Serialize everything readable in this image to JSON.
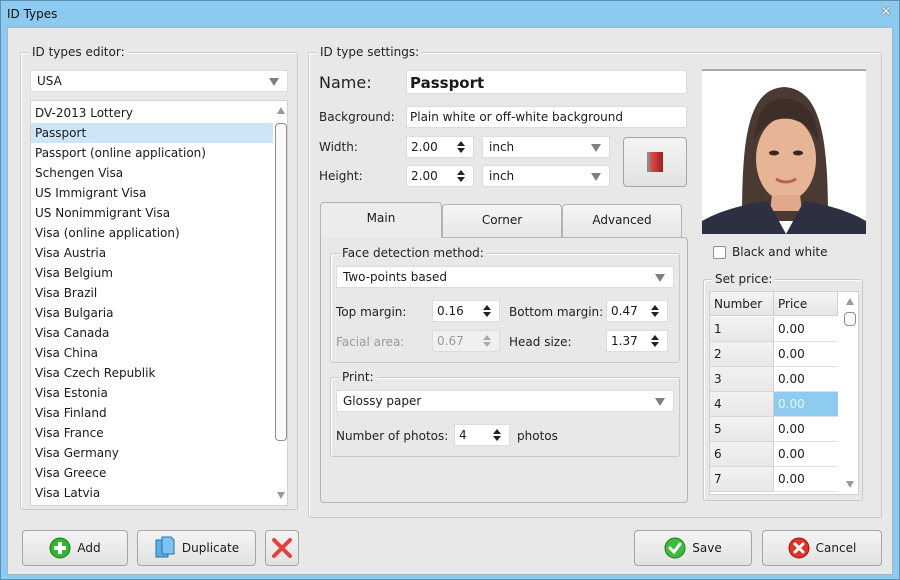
{
  "window": {
    "title": "ID Types",
    "close_icon": "close-icon"
  },
  "editor": {
    "group_label": "ID types editor:",
    "country_selected": "USA",
    "items": [
      {
        "label": "DV-2013 Lottery",
        "selected": false
      },
      {
        "label": "Passport",
        "selected": true
      },
      {
        "label": "Passport (online application)",
        "selected": false
      },
      {
        "label": "Schengen Visa",
        "selected": false
      },
      {
        "label": "US Immigrant Visa",
        "selected": false
      },
      {
        "label": "US Nonimmigrant Visa",
        "selected": false
      },
      {
        "label": "Visa (online application)",
        "selected": false
      },
      {
        "label": "Visa Austria",
        "selected": false
      },
      {
        "label": "Visa Belgium",
        "selected": false
      },
      {
        "label": "Visa Brazil",
        "selected": false
      },
      {
        "label": "Visa Bulgaria",
        "selected": false
      },
      {
        "label": "Visa Canada",
        "selected": false
      },
      {
        "label": "Visa China",
        "selected": false
      },
      {
        "label": "Visa Czech Republik",
        "selected": false
      },
      {
        "label": "Visa Estonia",
        "selected": false
      },
      {
        "label": "Visa Finland",
        "selected": false
      },
      {
        "label": "Visa France",
        "selected": false
      },
      {
        "label": "Visa Germany",
        "selected": false
      },
      {
        "label": "Visa Greece",
        "selected": false
      },
      {
        "label": "Visa Latvia",
        "selected": false
      }
    ]
  },
  "settings": {
    "group_label": "ID type settings:",
    "name_label": "Name:",
    "name_value": "Passport",
    "background_label": "Background:",
    "background_value": "Plain white or off-white background",
    "width_label": "Width:",
    "width_value": "2.00",
    "width_unit": "inch",
    "height_label": "Height:",
    "height_value": "2.00",
    "height_unit": "inch",
    "template_button_icon": "red-book-icon"
  },
  "tabs": [
    {
      "label": "Main",
      "active": true
    },
    {
      "label": "Corner",
      "active": false
    },
    {
      "label": "Advanced",
      "active": false
    }
  ],
  "main_tab": {
    "face_group_label": "Face detection method:",
    "face_method": "Two-points based",
    "top_margin_label": "Top margin:",
    "top_margin": "0.16",
    "bottom_margin_label": "Bottom margin:",
    "bottom_margin": "0.47",
    "facial_area_label": "Facial area:",
    "facial_area": "0.67",
    "head_size_label": "Head size:",
    "head_size": "1.37",
    "print_group_label": "Print:",
    "paper": "Glossy paper",
    "photos_label": "Number of photos:",
    "photos_value": "4",
    "photos_suffix": "photos"
  },
  "preview": {
    "bw_label": "Black and white",
    "bw_checked": false
  },
  "price": {
    "group_label": "Set price:",
    "col_number": "Number",
    "col_price": "Price",
    "rows": [
      {
        "number": "1",
        "price": "0.00",
        "selected": false
      },
      {
        "number": "2",
        "price": "0.00",
        "selected": false
      },
      {
        "number": "3",
        "price": "0.00",
        "selected": false
      },
      {
        "number": "4",
        "price": "0.00",
        "selected": true
      },
      {
        "number": "5",
        "price": "0.00",
        "selected": false
      },
      {
        "number": "6",
        "price": "0.00",
        "selected": false
      },
      {
        "number": "7",
        "price": "0.00",
        "selected": false
      }
    ]
  },
  "buttons": {
    "add": "Add",
    "duplicate": "Duplicate",
    "save": "Save",
    "cancel": "Cancel"
  },
  "colors": {
    "titlebar": "#8dcaef",
    "selection": "#cde6f7",
    "grid_selection": "#8fcbef"
  }
}
